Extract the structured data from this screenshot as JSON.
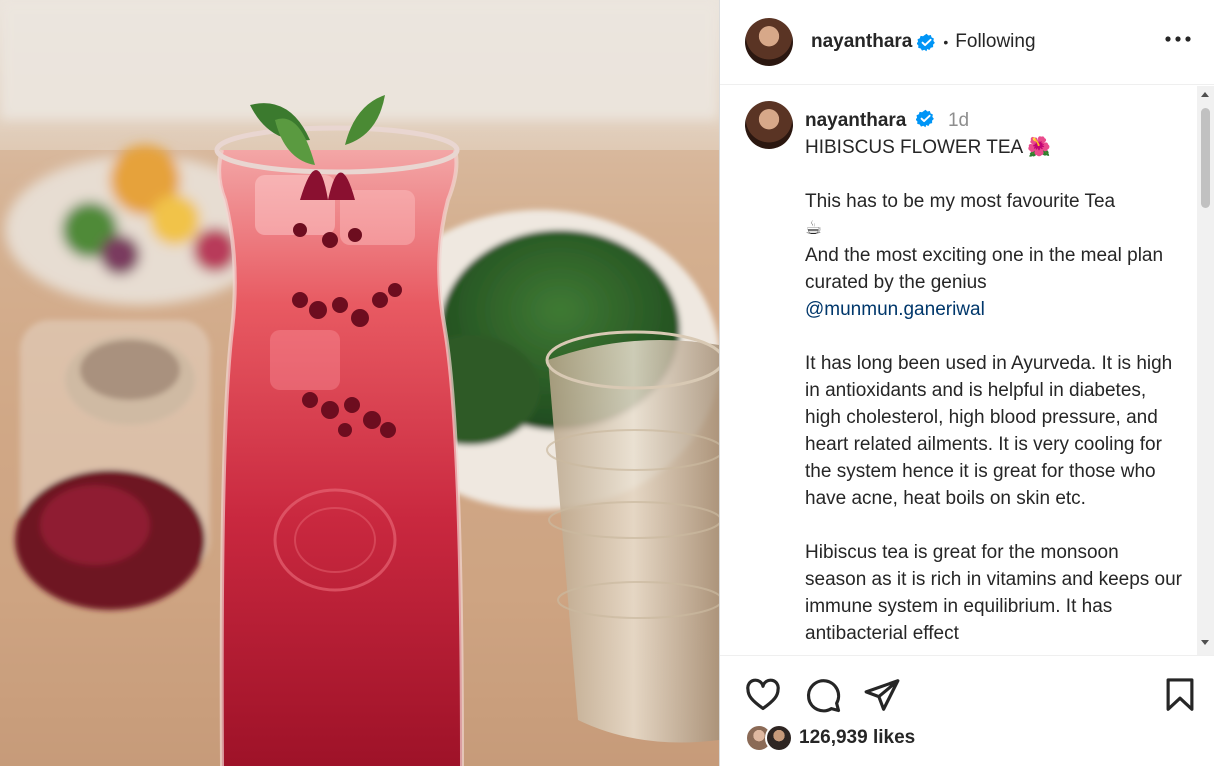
{
  "post": {
    "username": "nayanthara",
    "separator": "•",
    "follow_status": "Following",
    "more_icon": "more-horizontal-icon",
    "verified_color": "#0095f6"
  },
  "caption": {
    "username": "nayanthara",
    "time": "1d",
    "line1": "HIBISCUS FLOWER TEA 🌺",
    "line2": "This has to be my most favourite Tea",
    "line2_emoji": "☕",
    "line3": "And the most exciting one in the meal plan curated by the genius",
    "mention": "@munmun.ganeriwal",
    "para2": "It has long been used in Ayurveda. It is high in antioxidants and is helpful in diabetes, high cholesterol, high blood pressure, and heart related ailments. It is very cooling for the system hence it is great for those who have acne, heat boils on skin etc.",
    "para3": "Hibiscus tea is great for the monsoon season as it is rich in vitamins and keeps our immune system in equilibrium. It has antibacterial effect"
  },
  "actions": {
    "like_icon": "heart-icon",
    "comment_icon": "comment-icon",
    "share_icon": "share-icon",
    "save_icon": "bookmark-icon",
    "likes_text": "126,939 likes"
  },
  "colors": {
    "text": "#262626",
    "secondary": "#8e8e8e",
    "mention": "#00376b",
    "drink": "#c8243a"
  }
}
